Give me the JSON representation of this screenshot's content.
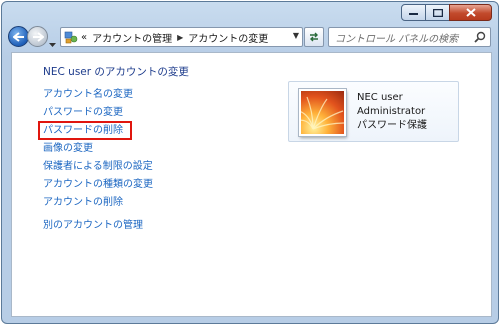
{
  "navigation": {
    "recent_pages_arrow": "chevron-down-icon"
  },
  "address": {
    "overflow": "«",
    "segments": [
      "アカウントの管理",
      "アカウントの変更"
    ]
  },
  "search": {
    "placeholder": "コントロール パネルの検索"
  },
  "page": {
    "title": "NEC user のアカウントの変更"
  },
  "links": [
    "アカウント名の変更",
    "パスワードの変更",
    "パスワードの削除",
    "画像の変更",
    "保護者による制限の設定",
    "アカウントの種類の変更",
    "アカウントの削除",
    "別のアカウントの管理"
  ],
  "highlighted_link_index": 2,
  "user": {
    "name": "NEC user",
    "role": "Administrator",
    "status": "パスワード保護"
  },
  "colors": {
    "link": "#1d67c2",
    "title": "#1e3c8c",
    "highlight": "#e0160e"
  }
}
